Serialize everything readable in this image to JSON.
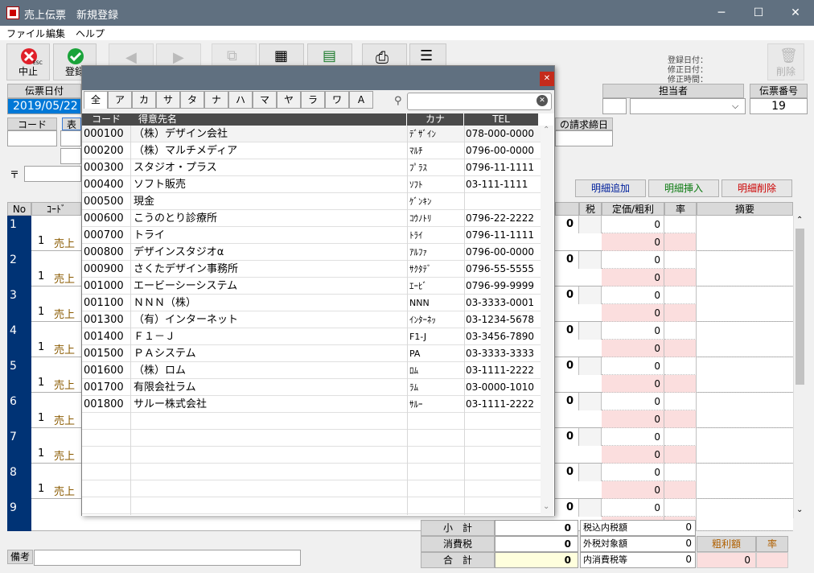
{
  "window": {
    "title": "売上伝票　新規登録"
  },
  "menu": [
    "ファイル",
    "編集",
    "ヘルプ"
  ],
  "toolbar": {
    "cancel": "中止",
    "cancel_key": "ESC",
    "register": "登録",
    "delete": "削除",
    "registered_date": "登録日付：",
    "modified_date": "修正日付：",
    "modified_time": "修正時間："
  },
  "header": {
    "slip_date_label": "伝票日付",
    "slip_date": "2019/05/22",
    "staff_label": "担当者",
    "slip_no_label": "伝票番号",
    "slip_no": "19",
    "code_label": "コード",
    "partial_label": "表",
    "closing_label": "の請求締日",
    "zip": "〒"
  },
  "buttons": {
    "add": "明細追加",
    "insert": "明細挿入",
    "delete": "明細削除"
  },
  "detail_header": {
    "no": "No",
    "code": "ｺｰﾄﾞ",
    "tax": "税",
    "price": "定価/粗利",
    "rate": "率",
    "summary": "摘要"
  },
  "rows": [
    {
      "no": "1",
      "qty": "1",
      "type": "売上",
      "a": "0",
      "b": "0",
      "c": "0"
    },
    {
      "no": "2",
      "qty": "1",
      "type": "売上",
      "a": "0",
      "b": "0",
      "c": "0"
    },
    {
      "no": "3",
      "qty": "1",
      "type": "売上",
      "a": "0",
      "b": "0",
      "c": "0"
    },
    {
      "no": "4",
      "qty": "1",
      "type": "売上",
      "a": "0",
      "b": "0",
      "c": "0"
    },
    {
      "no": "5",
      "qty": "1",
      "type": "売上",
      "a": "0",
      "b": "0",
      "c": "0"
    },
    {
      "no": "6",
      "qty": "1",
      "type": "売上",
      "a": "0",
      "b": "0",
      "c": "0"
    },
    {
      "no": "7",
      "qty": "1",
      "type": "売上",
      "a": "0",
      "b": "0",
      "c": "0"
    },
    {
      "no": "8",
      "qty": "1",
      "type": "売上",
      "a": "0",
      "b": "0",
      "c": "0"
    },
    {
      "no": "9",
      "qty": "",
      "type": "",
      "a": "0",
      "b": "0",
      "c": ""
    }
  ],
  "totals": {
    "subtotal": "小　計",
    "subtotal_val": "0",
    "tax": "消費税",
    "tax_val": "0",
    "total": "合　計",
    "total_val": "0",
    "incl_tax": "税込内税額",
    "incl_tax_val": "0",
    "ext_base": "外税対象額",
    "ext_base_val": "0",
    "int_tax": "内消費税等",
    "int_tax_val": "0",
    "gross": "粗利額",
    "gross_val": "0",
    "rate": "率"
  },
  "remarks_label": "備考",
  "modal": {
    "tabs": [
      "全",
      "ア",
      "カ",
      "サ",
      "タ",
      "ナ",
      "ハ",
      "マ",
      "ヤ",
      "ラ",
      "ワ",
      "A"
    ],
    "search_placeholder": "",
    "columns": {
      "code": "コード",
      "name": "得意先名",
      "kana": "カナ",
      "tel": "TEL"
    },
    "customers": [
      {
        "code": "000100",
        "name": "（株）デザイン会社",
        "kana": "ﾃﾞｻﾞｲﾝ",
        "tel": "078-000-0000"
      },
      {
        "code": "000200",
        "name": "（株）マルチメディア",
        "kana": "ﾏﾙﾁ",
        "tel": "0796-00-0000"
      },
      {
        "code": "000300",
        "name": "スタジオ・プラス",
        "kana": "ﾌﾟﾗｽ",
        "tel": "0796-11-1111"
      },
      {
        "code": "000400",
        "name": "ソフト販売",
        "kana": "ｿﾌﾄ",
        "tel": "03-111-1111"
      },
      {
        "code": "000500",
        "name": "現金",
        "kana": "ｹﾞﾝｷﾝ",
        "tel": ""
      },
      {
        "code": "000600",
        "name": "こうのとり診療所",
        "kana": "ｺｳﾉﾄﾘ",
        "tel": "0796-22-2222"
      },
      {
        "code": "000700",
        "name": "トライ",
        "kana": "ﾄﾗｲ",
        "tel": "0796-11-1111"
      },
      {
        "code": "000800",
        "name": "デザインスタジオα",
        "kana": "ｱﾙﾌｧ",
        "tel": "0796-00-0000"
      },
      {
        "code": "000900",
        "name": "さくたデザイン事務所",
        "kana": "ｻｸﾀﾃﾞ",
        "tel": "0796-55-5555"
      },
      {
        "code": "001000",
        "name": "エービーシーシステム",
        "kana": "ｴｰﾋﾞ",
        "tel": "0796-99-9999"
      },
      {
        "code": "001100",
        "name": "ＮＮＮ（株）",
        "kana": "NNN",
        "tel": "03-3333-0001"
      },
      {
        "code": "001300",
        "name": "（有）インターネット",
        "kana": "ｲﾝﾀｰﾈｯ",
        "tel": "03-1234-5678"
      },
      {
        "code": "001400",
        "name": "Ｆ１－Ｊ",
        "kana": "F1-J",
        "tel": "03-3456-7890"
      },
      {
        "code": "001500",
        "name": "ＰＡシステム",
        "kana": "PA",
        "tel": "03-3333-3333"
      },
      {
        "code": "001600",
        "name": "（株）ロム",
        "kana": "ﾛﾑ",
        "tel": "03-1111-2222"
      },
      {
        "code": "001700",
        "name": "有限会社ラム",
        "kana": "ﾗﾑ",
        "tel": "03-0000-1010"
      },
      {
        "code": "001800",
        "name": "サルー株式会社",
        "kana": "ｻﾙｰ",
        "tel": "03-1111-2222"
      }
    ]
  }
}
